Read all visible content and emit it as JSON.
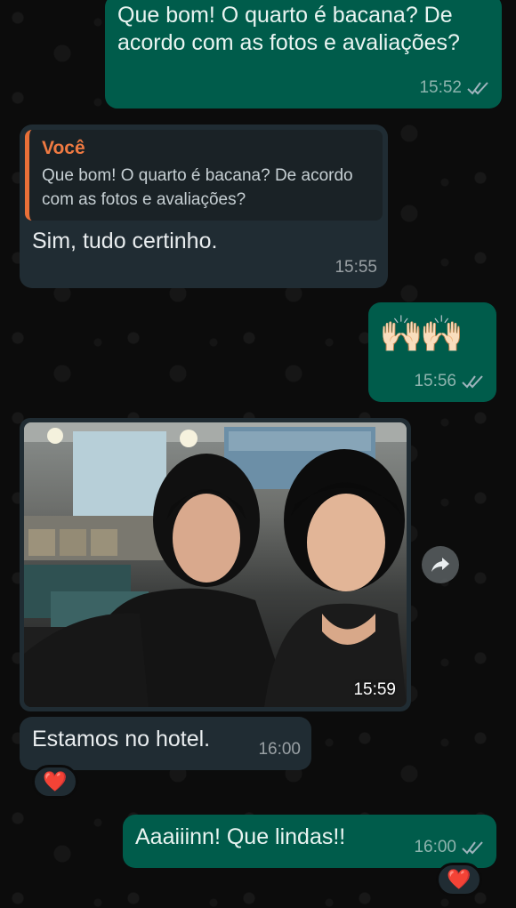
{
  "messages": [
    {
      "type": "out",
      "text": "Que bom! O quarto é bacana? De acordo com as fotos e avaliações?",
      "time": "15:52",
      "status": "read"
    },
    {
      "type": "in",
      "quote_author": "Você",
      "quote_text": "Que bom! O quarto é bacana? De acordo com as fotos e avaliações?",
      "text": "Sim, tudo certinho.",
      "time": "15:55"
    },
    {
      "type": "out",
      "text": "🙌🏻🙌🏻",
      "time": "15:56",
      "status": "read"
    },
    {
      "type": "in-image",
      "time": "15:59"
    },
    {
      "type": "in",
      "text": "Estamos no hotel.",
      "time": "16:00",
      "reaction": "❤️"
    },
    {
      "type": "out",
      "text": "Aaaiiinn! Que lindas!!",
      "time": "16:00",
      "status": "read",
      "reaction": "❤️"
    }
  ],
  "icons": {
    "read_ticks": "double-check-icon",
    "forward": "forward-arrow-icon",
    "reaction": "heart-icon"
  },
  "colors": {
    "outgoing_bubble": "#005c4b",
    "incoming_bubble": "#202c33",
    "quote_accent": "#e97038",
    "read_tick": "#9fb4bd"
  }
}
